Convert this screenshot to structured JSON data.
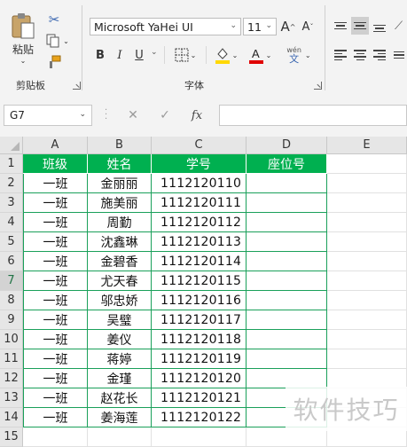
{
  "ribbon": {
    "clipboard": {
      "paste_label": "粘贴",
      "group_label": "剪贴板"
    },
    "font": {
      "font_name": "Microsoft YaHei UI",
      "font_size": "11",
      "group_label": "字体",
      "bold": "B",
      "italic": "I",
      "underline": "U",
      "grow": "A",
      "shrink": "A",
      "wen_label": "wén",
      "wen_char": "文",
      "fill_color": "#ffd800",
      "font_color": "#e00000"
    },
    "icons": [
      "cut-icon",
      "copy-icon",
      "format-painter-icon",
      "border-icon",
      "fill-color-icon",
      "font-color-icon",
      "phonetic-icon",
      "align-icon"
    ]
  },
  "formula_bar": {
    "name_box": "G7",
    "cancel": "✕",
    "enter": "✓",
    "fx": "fx",
    "formula": ""
  },
  "sheet": {
    "columns": [
      "A",
      "B",
      "C",
      "D",
      "E"
    ],
    "rows": [
      "1",
      "2",
      "3",
      "4",
      "5",
      "6",
      "7",
      "8",
      "9",
      "10",
      "11",
      "12",
      "13",
      "14",
      "15"
    ],
    "selected_row": "7",
    "header": [
      "班级",
      "姓名",
      "学号",
      "座位号"
    ],
    "data": [
      [
        "一班",
        "金丽丽",
        "1112120110",
        ""
      ],
      [
        "一班",
        "施美丽",
        "1112120111",
        ""
      ],
      [
        "一班",
        "周勤",
        "1112120112",
        ""
      ],
      [
        "一班",
        "沈鑫琳",
        "1112120113",
        ""
      ],
      [
        "一班",
        "金碧香",
        "1112120114",
        ""
      ],
      [
        "一班",
        "尤天春",
        "1112120115",
        ""
      ],
      [
        "一班",
        "邬忠娇",
        "1112120116",
        ""
      ],
      [
        "一班",
        "吴璧",
        "1112120117",
        ""
      ],
      [
        "一班",
        "姜仪",
        "1112120118",
        ""
      ],
      [
        "一班",
        "蒋婷",
        "1112120119",
        ""
      ],
      [
        "一班",
        "金瑾",
        "1112120120",
        ""
      ],
      [
        "一班",
        "赵花长",
        "1112120121",
        ""
      ],
      [
        "一班",
        "姜海莲",
        "1112120122",
        ""
      ]
    ],
    "header_color": "#00b050",
    "border_color": "#1aa05a"
  },
  "watermark": "软件技巧"
}
